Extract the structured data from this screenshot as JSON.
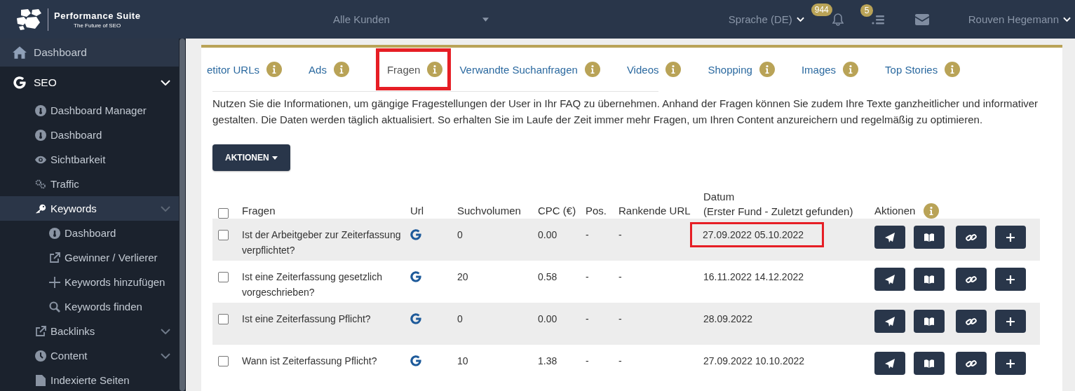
{
  "header": {
    "logo": {
      "title": "Performance Suite",
      "tagline": "The Future of SEO"
    },
    "customer_select": "Alle Kunden",
    "language": "Sprache (DE)",
    "notifications_badge": "944",
    "tasks_badge": "5",
    "user": "Rouven Hegemann"
  },
  "sidebar": {
    "items": [
      {
        "label": "Dashboard",
        "selected": false
      },
      {
        "label": "SEO",
        "selected": false,
        "expandable": true,
        "expanded": true,
        "children": [
          {
            "label": "Dashboard Manager",
            "selected": false
          },
          {
            "label": "Dashboard",
            "selected": false
          },
          {
            "label": "Sichtbarkeit",
            "selected": false
          },
          {
            "label": "Traffic",
            "selected": false
          },
          {
            "label": "Keywords",
            "selected": true,
            "expandable": true,
            "expanded": true,
            "children": [
              {
                "label": "Dashboard",
                "selected": false
              },
              {
                "label": "Gewinner / Verlierer",
                "selected": false
              },
              {
                "label": "Keywords hinzufügen",
                "selected": false
              },
              {
                "label": "Keywords finden",
                "selected": false
              }
            ]
          },
          {
            "label": "Backlinks",
            "selected": false,
            "expandable": true,
            "expanded": false
          },
          {
            "label": "Content",
            "selected": false,
            "expandable": true,
            "expanded": false
          },
          {
            "label": "Indexierte Seiten",
            "selected": false
          }
        ]
      }
    ]
  },
  "tabs": [
    {
      "label": "etitor URLs",
      "selected": false,
      "highlighted": false
    },
    {
      "label": "Ads",
      "selected": false,
      "highlighted": false
    },
    {
      "label": "Fragen",
      "selected": true,
      "highlighted": true
    },
    {
      "label": "Verwandte Suchanfragen",
      "selected": false,
      "highlighted": false
    },
    {
      "label": "Videos",
      "selected": false,
      "highlighted": false
    },
    {
      "label": "Shopping",
      "selected": false,
      "highlighted": false
    },
    {
      "label": "Images",
      "selected": false,
      "highlighted": false
    },
    {
      "label": "Top Stories",
      "selected": false,
      "highlighted": false
    }
  ],
  "description": "Nutzen Sie die Informationen, um gängige Fragestellungen der User in Ihr FAQ zu übernehmen. Anhand der Fragen können Sie zudem Ihre Texte ganzheitlicher und informativer gestalten. Die Daten werden täglich aktualisiert. So erhalten Sie im Laufe der Zeit immer mehr Fragen, um Ihren Content anzureichern und regelmäßig zu optimieren.",
  "actions_button": "AKTIONEN",
  "table": {
    "select_all_checked": false,
    "columns": [
      {
        "label": "Fragen"
      },
      {
        "label": "Url"
      },
      {
        "label": "Suchvolumen"
      },
      {
        "label": "CPC (€)"
      },
      {
        "label": "Pos."
      },
      {
        "label": "Rankende URL"
      },
      {
        "label": "Datum",
        "sublabel": "(Erster Fund - Zuletzt gefunden)"
      },
      {
        "label": "Aktionen",
        "info": true
      }
    ],
    "rows": [
      {
        "checked": false,
        "question": "Ist der Arbeitgeber zur Zeiterfassung verpflichtet?",
        "search_volume": "0",
        "cpc": "0.00",
        "pos": "-",
        "ranking_url": "-",
        "date": "27.09.2022 05.10.2022",
        "date_highlighted": true
      },
      {
        "checked": false,
        "question": "Ist eine Zeiterfassung gesetzlich vorgeschrieben?",
        "search_volume": "20",
        "cpc": "0.58",
        "pos": "-",
        "ranking_url": "-",
        "date": "16.11.2022 14.12.2022",
        "date_highlighted": false
      },
      {
        "checked": false,
        "question": "Ist eine Zeiterfassung Pflicht?",
        "search_volume": "0",
        "cpc": "0.00",
        "pos": "-",
        "ranking_url": "-",
        "date": "28.09.2022",
        "date_highlighted": false
      },
      {
        "checked": false,
        "question": "Wann ist Zeiterfassung Pflicht?",
        "search_volume": "10",
        "cpc": "1.38",
        "pos": "-",
        "ranking_url": "-",
        "date": "27.09.2022 10.10.2022",
        "date_highlighted": false
      }
    ]
  }
}
